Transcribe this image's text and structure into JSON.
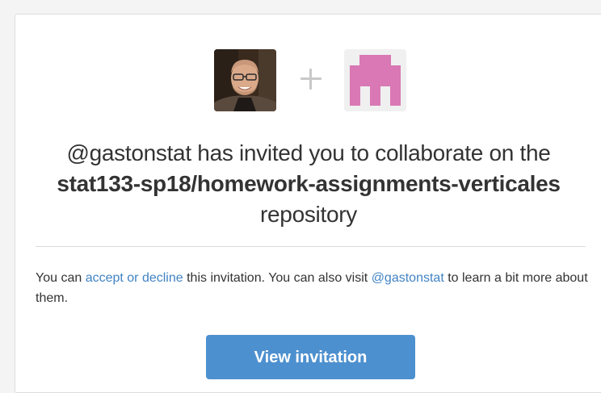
{
  "invite": {
    "inviter": "@gastonstat",
    "invited_text": " has invited you to collaborate on the",
    "repo_name": "stat133-sp18/homework-assignments-verticales",
    "repo_suffix": " repository",
    "plus_symbol": "+",
    "user_avatar_icon": "user-photo",
    "org_avatar_icon": "pixel-identicon",
    "org_avatar_color": "#d978b4"
  },
  "message": {
    "prefix": "You can ",
    "accept_link": "accept or decline",
    "middle": " this invitation. You can also visit ",
    "profile_link": "@gastonstat",
    "suffix": " to learn a bit more about them."
  },
  "button": {
    "label": "View invitation",
    "color": "#4d90cf"
  },
  "colors": {
    "link": "#4183c4",
    "text": "#333333"
  }
}
